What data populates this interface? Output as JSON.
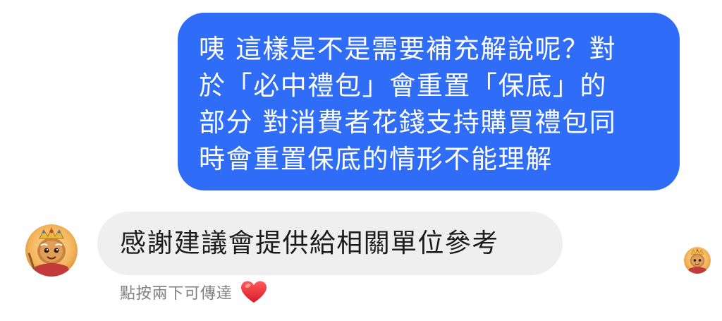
{
  "conversation": {
    "sent_message": {
      "lines": [
        "咦 這樣是不是需要補充解說呢？對",
        "於「必中禮包」會重置「保底」的",
        "部分 對消費者花錢支持購買禮包同",
        "時會重置保底的情形不能理解"
      ],
      "bubble_color": "#2f6cf7"
    },
    "received_message": {
      "text": "感謝建議會提供給相關單位參考",
      "bubble_color": "#efefef"
    },
    "double_tap_hint": {
      "text": "點按兩下可傳達",
      "icon": "heart-icon"
    },
    "sender_avatar_icon": "cookie-character-avatar-icon",
    "read_receipt_icon": "cookie-character-avatar-icon"
  }
}
